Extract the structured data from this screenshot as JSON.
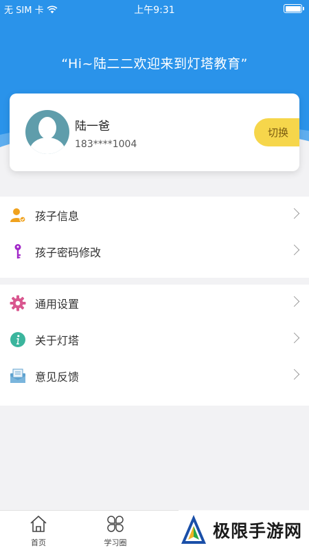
{
  "status_bar": {
    "carrier": "无 SIM 卡",
    "time": "上午9:31"
  },
  "header": {
    "welcome": "“Hi~陆二二欢迎来到灯塔教育”"
  },
  "profile": {
    "name": "陆一爸",
    "phone": "183****1004",
    "switch_label": "切换"
  },
  "menu": {
    "group1": [
      {
        "label": "孩子信息",
        "icon": "child-info-icon"
      },
      {
        "label": "孩子密码修改",
        "icon": "key-icon"
      }
    ],
    "group2": [
      {
        "label": "通用设置",
        "icon": "gear-icon"
      },
      {
        "label": "关于灯塔",
        "icon": "info-icon"
      },
      {
        "label": "意见反馈",
        "icon": "feedback-icon"
      }
    ]
  },
  "tabbar": {
    "home": "首页",
    "study_circle": "学习圈"
  },
  "watermark": {
    "text": "极限手游网"
  },
  "colors": {
    "header_blue": "#2a93ea",
    "switch_yellow": "#f6d64b",
    "avatar_teal": "#5f9dab"
  }
}
